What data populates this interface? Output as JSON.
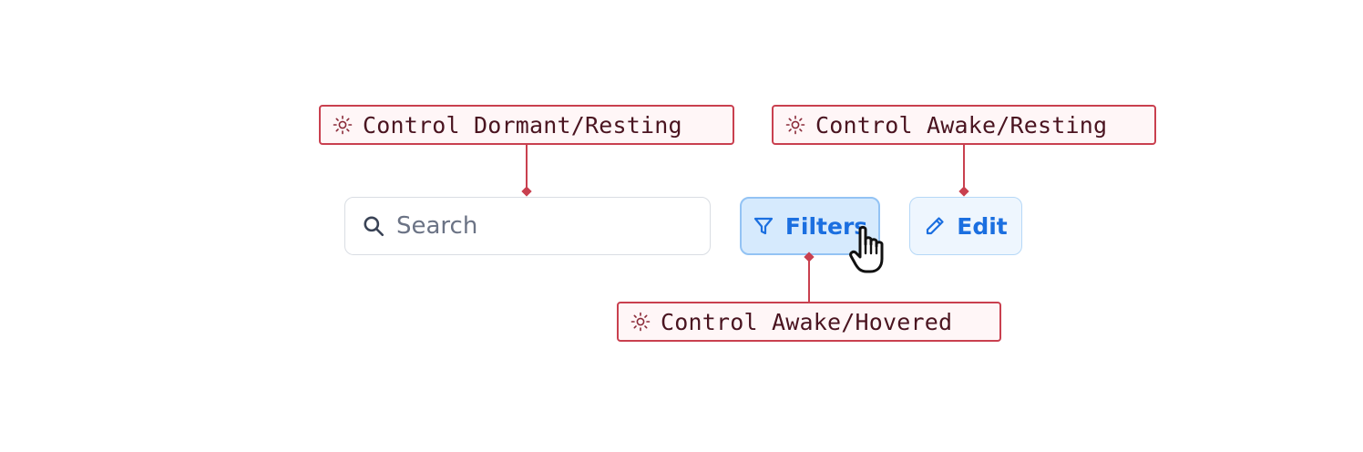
{
  "annotations": {
    "dormant_resting": "Control Dormant/Resting",
    "awake_resting": "Control Awake/Resting",
    "awake_hovered": "Control Awake/Hovered",
    "icon": "sun-icon",
    "color": "#c9404f"
  },
  "search": {
    "placeholder": "Search",
    "icon": "search-icon"
  },
  "filters_button": {
    "label": "Filters",
    "icon": "filter-icon",
    "state": "hovered"
  },
  "edit_button": {
    "label": "Edit",
    "icon": "pencil-icon",
    "state": "resting"
  },
  "colors": {
    "accent": "#1b6fe0",
    "hover_background": "#d6eafd",
    "resting_background": "#eef6fe"
  }
}
